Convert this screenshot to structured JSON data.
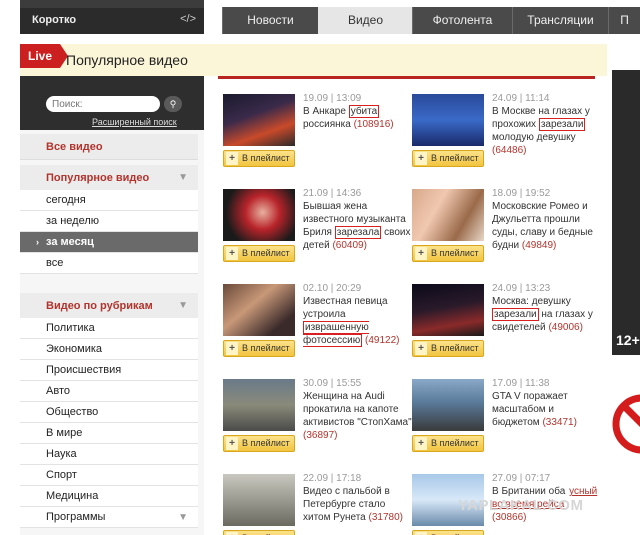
{
  "header": {
    "short_label": "Коротко",
    "code_icon_text": "</>",
    "nav_tabs": [
      {
        "label": "Новости"
      },
      {
        "label": "Видео"
      },
      {
        "label": "Фотолента"
      },
      {
        "label": "Трансляции"
      },
      {
        "label": "П"
      }
    ]
  },
  "title_bar": {
    "live_label": "Live",
    "page_title": "Популярное видео"
  },
  "sidebar": {
    "search_placeholder": "Поиск:",
    "advanced_search": "Расширенный поиск",
    "all_videos": "Все видео",
    "popular_heading": "Популярное видео",
    "popular_items": [
      {
        "label": "сегодня"
      },
      {
        "label": "за неделю"
      },
      {
        "label": "за месяц"
      },
      {
        "label": "все"
      }
    ],
    "rubrics_heading": "Видео по рубрикам",
    "rubric_items": [
      {
        "label": "Политика"
      },
      {
        "label": "Экономика"
      },
      {
        "label": "Происшествия"
      },
      {
        "label": "Авто"
      },
      {
        "label": "Общество"
      },
      {
        "label": "В мире"
      },
      {
        "label": "Наука"
      },
      {
        "label": "Спорт"
      },
      {
        "label": "Медицина"
      },
      {
        "label": "Программы"
      }
    ]
  },
  "playlist_label": "В плейлист",
  "videos": [
    {
      "date": "19.09 | 13:09",
      "t1": "В Анкаре ",
      "hl": "убита",
      "t2": " россиянка",
      "views": "(108916)"
    },
    {
      "date": "24.09 | 11:14",
      "t1": "В Москве на глазах у прохожих ",
      "hl": "зарезали",
      "t2": " молодую девушку",
      "views": "(64486)"
    },
    {
      "date": "21.09 | 14:36",
      "t1": "Бывшая жена известного музыканта Бриля ",
      "hl": "зарезала",
      "t2": " своих детей",
      "views": "(60409)"
    },
    {
      "date": "18.09 | 19:52",
      "t1": "Московские Ромео и Джульетта прошли суды, славу и бедные будни",
      "hl": "",
      "t2": "",
      "views": "(49849)"
    },
    {
      "date": "02.10 | 20:29",
      "t1": "Известная певица устроила ",
      "hl": "изврашенную фотосессию",
      "t2": "",
      "views": "(49122)"
    },
    {
      "date": "24.09 | 13:23",
      "t1": "Москва: девушку ",
      "hl": "зарезали",
      "t2": " на глазах у свидетелей",
      "views": "(49006)"
    },
    {
      "date": "30.09 | 15:55",
      "t1": "Женщина на Audi прокатила на капоте активистов \"СтопХама\"",
      "hl": "",
      "t2": "",
      "views": "(36897)"
    },
    {
      "date": "17.09 | 11:38",
      "t1": "GTA V поражает масштабом и бюджетом",
      "hl": "",
      "t2": "",
      "views": "(33471)"
    },
    {
      "date": "22.09 | 17:18",
      "t1": "Видео с пальбой в Петербурге стало хитом Рунета",
      "hl": "",
      "t2": "",
      "views": "(31780)"
    },
    {
      "date": "27.09 | 07:17",
      "t1": "В Британии оба ",
      "hl": "",
      "t2": "",
      "views": "(30866)",
      "hl_tail": "усный во время рейса"
    }
  ],
  "right_ad": {
    "number": "12+"
  },
  "watermark": "YAPLAKAL.COM",
  "colors": {
    "accent_red": "#b8241f",
    "link_red": "#b2342d",
    "button_yellow": "#f2c440",
    "selected_gray": "#6a6a6a"
  }
}
